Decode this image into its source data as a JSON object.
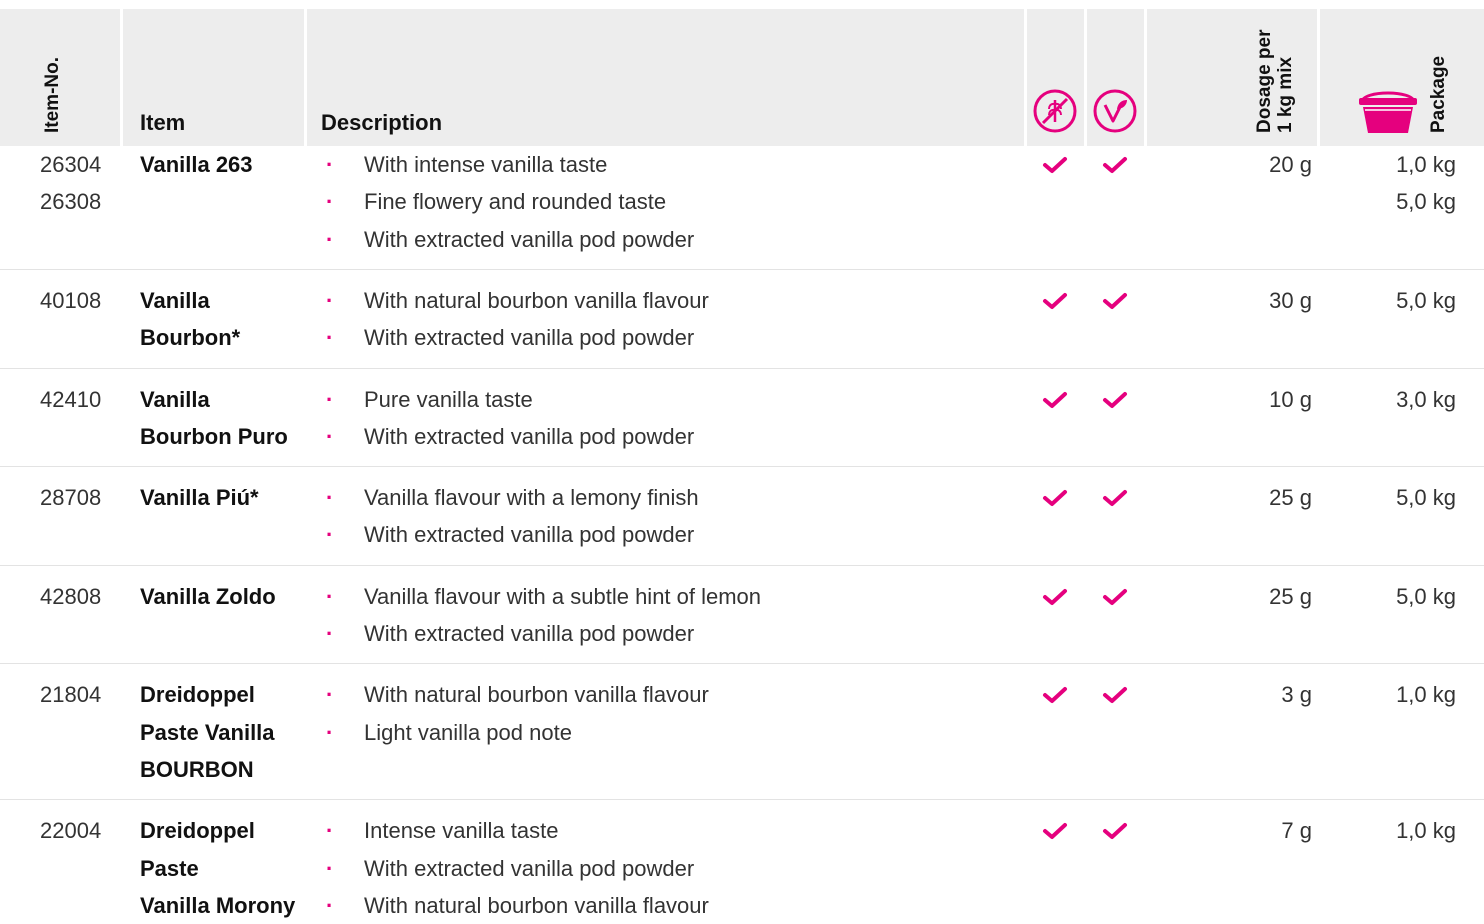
{
  "header": {
    "item_no": "Item-No.",
    "item": "Item",
    "description": "Description",
    "dosage_line1": "Dosage per",
    "dosage_line2": "1 kg mix",
    "package": "Package",
    "icons": [
      "gluten-free-icon",
      "vegan-icon",
      "bucket-icon"
    ]
  },
  "colors": {
    "accent": "#e5007e",
    "header_bg": "#ededed",
    "separator": "#e3e3e3"
  },
  "rows": [
    {
      "numbers": [
        "26304",
        "26308"
      ],
      "name": [
        "Vanilla 263"
      ],
      "description": [
        "With intense vanilla taste",
        "Fine flowery and rounded taste",
        "With extracted vanilla pod powder"
      ],
      "gluten_free": true,
      "vegan": true,
      "dosage": "20 g",
      "package": [
        "1,0 kg",
        "5,0 kg"
      ]
    },
    {
      "numbers": [
        "40108"
      ],
      "name": [
        "Vanilla",
        "Bourbon*"
      ],
      "description": [
        "With natural bourbon vanilla flavour",
        "With extracted vanilla pod powder"
      ],
      "gluten_free": true,
      "vegan": true,
      "dosage": "30 g",
      "package": [
        "5,0 kg"
      ]
    },
    {
      "numbers": [
        "42410"
      ],
      "name": [
        "Vanilla",
        "Bourbon Puro"
      ],
      "description": [
        "Pure vanilla taste",
        "With extracted vanilla pod powder"
      ],
      "gluten_free": true,
      "vegan": true,
      "dosage": "10 g",
      "package": [
        "3,0 kg"
      ]
    },
    {
      "numbers": [
        "28708"
      ],
      "name": [
        "Vanilla Piú*"
      ],
      "description": [
        "Vanilla flavour with a lemony finish",
        "With extracted vanilla pod powder"
      ],
      "gluten_free": true,
      "vegan": true,
      "dosage": "25 g",
      "package": [
        "5,0 kg"
      ]
    },
    {
      "numbers": [
        "42808"
      ],
      "name": [
        "Vanilla Zoldo"
      ],
      "description": [
        "Vanilla flavour with a subtle hint of lemon",
        "With extracted vanilla pod powder"
      ],
      "gluten_free": true,
      "vegan": true,
      "dosage": "25 g",
      "package": [
        "5,0 kg"
      ]
    },
    {
      "numbers": [
        "21804"
      ],
      "name": [
        "Dreidoppel",
        "Paste Vanilla",
        "BOURBON"
      ],
      "description": [
        "With natural bourbon vanilla flavour",
        "Light vanilla pod note"
      ],
      "gluten_free": true,
      "vegan": true,
      "dosage": "3 g",
      "package": [
        "1,0 kg"
      ]
    },
    {
      "numbers": [
        "22004"
      ],
      "name": [
        "Dreidoppel",
        "Paste",
        "Vanilla Morony"
      ],
      "description": [
        "Intense vanilla taste",
        "With extracted vanilla pod powder",
        "With natural bourbon vanilla flavour"
      ],
      "gluten_free": true,
      "vegan": true,
      "dosage": "7 g",
      "package": [
        "1,0 kg"
      ]
    }
  ]
}
